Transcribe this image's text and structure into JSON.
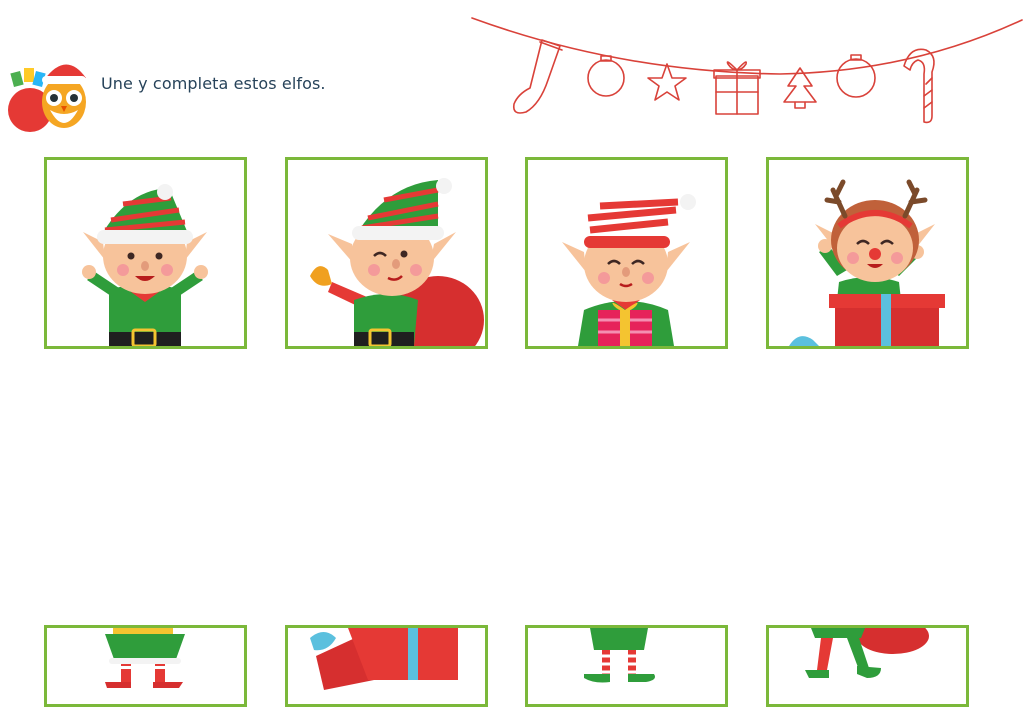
{
  "worksheet": {
    "instruction": "Une y completa estos elfos.",
    "mascot_icon": "owl-santa-icon",
    "garland_icon": "christmas-garland-icon"
  },
  "colors": {
    "card_border": "#7bb83a",
    "title_text": "#27435a",
    "garland": "#d9423a",
    "elf_green": "#2f9d3b",
    "elf_red": "#e53935"
  },
  "cards_top": [
    {
      "name": "elf-1-upper",
      "icon": "elf-waving-icon"
    },
    {
      "name": "elf-2-upper",
      "icon": "elf-bell-sack-icon"
    },
    {
      "name": "elf-3-upper",
      "icon": "elf-gift-icon"
    },
    {
      "name": "elf-4-upper",
      "icon": "elf-reindeer-box-icon"
    }
  ],
  "cards_bottom": [
    {
      "name": "legs-a",
      "icon": "elf-legs-icon"
    },
    {
      "name": "gift-box-bottom",
      "icon": "gift-box-icon"
    },
    {
      "name": "legs-b",
      "icon": "elf-legs-icon"
    },
    {
      "name": "legs-c",
      "icon": "elf-legs-sack-icon"
    }
  ]
}
